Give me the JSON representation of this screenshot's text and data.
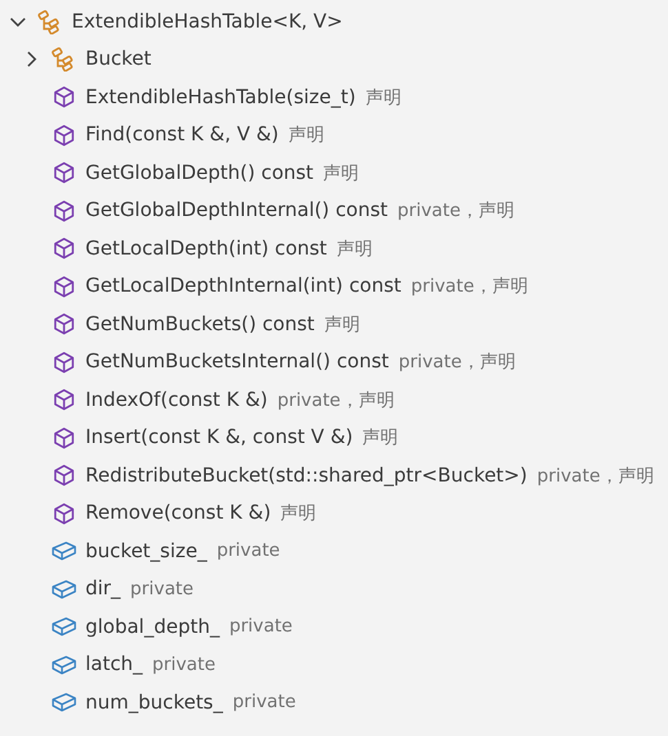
{
  "outline": [
    {
      "kind": "class",
      "label": "ExtendibleHashTable<K, V>",
      "expanded": true,
      "children": [
        {
          "kind": "class",
          "label": "Bucket",
          "expanded": false
        },
        {
          "kind": "method",
          "label": "ExtendibleHashTable(size_t)",
          "description": "声明"
        },
        {
          "kind": "method",
          "label": "Find(const K &, V &)",
          "description": "声明"
        },
        {
          "kind": "method",
          "label": "GetGlobalDepth() const",
          "description": "声明"
        },
        {
          "kind": "method",
          "label": "GetGlobalDepthInternal() const",
          "description": "private，声明"
        },
        {
          "kind": "method",
          "label": "GetLocalDepth(int) const",
          "description": "声明"
        },
        {
          "kind": "method",
          "label": "GetLocalDepthInternal(int) const",
          "description": "private，声明"
        },
        {
          "kind": "method",
          "label": "GetNumBuckets() const",
          "description": "声明"
        },
        {
          "kind": "method",
          "label": "GetNumBucketsInternal() const",
          "description": "private，声明"
        },
        {
          "kind": "method",
          "label": "IndexOf(const K &)",
          "description": "private，声明"
        },
        {
          "kind": "method",
          "label": "Insert(const K &, const V &)",
          "description": "声明"
        },
        {
          "kind": "method",
          "label": "RedistributeBucket(std::shared_ptr<Bucket>)",
          "description": "private，声明"
        },
        {
          "kind": "method",
          "label": "Remove(const K &)",
          "description": "声明"
        },
        {
          "kind": "field",
          "label": "bucket_size_",
          "description": "private"
        },
        {
          "kind": "field",
          "label": "dir_",
          "description": "private"
        },
        {
          "kind": "field",
          "label": "global_depth_",
          "description": "private"
        },
        {
          "kind": "field",
          "label": "latch_",
          "description": "private"
        },
        {
          "kind": "field",
          "label": "num_buckets_",
          "description": "private"
        }
      ]
    }
  ]
}
